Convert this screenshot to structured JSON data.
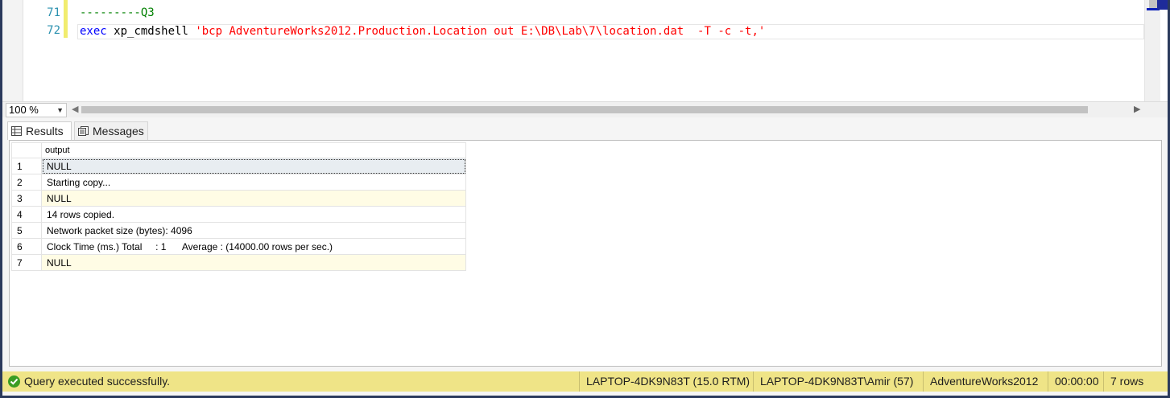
{
  "editor": {
    "lines": [
      {
        "number": "71",
        "text": "---------Q3"
      },
      {
        "number": "72",
        "keyword": "exec",
        "proc": "xp_cmdshell",
        "string": "'bcp AdventureWorks2012.Production.Location out E:\\DB\\Lab\\7\\location.dat  -T -c -t,'"
      }
    ]
  },
  "zoom": {
    "value": "100 %"
  },
  "tabs": {
    "results": "Results",
    "messages": "Messages"
  },
  "grid": {
    "column": "output",
    "rows": [
      {
        "n": "1",
        "v": "NULL"
      },
      {
        "n": "2",
        "v": "Starting copy..."
      },
      {
        "n": "3",
        "v": "NULL"
      },
      {
        "n": "4",
        "v": "14 rows copied."
      },
      {
        "n": "5",
        "v": "Network packet size (bytes): 4096"
      },
      {
        "n": "6",
        "v": "Clock Time (ms.) Total     : 1      Average : (14000.00 rows per sec.)"
      },
      {
        "n": "7",
        "v": "NULL"
      }
    ]
  },
  "status": {
    "message": "Query executed successfully.",
    "server": "LAPTOP-4DK9N83T (15.0 RTM)",
    "user": "LAPTOP-4DK9N83T\\Amir (57)",
    "database": "AdventureWorks2012",
    "elapsed": "00:00:00",
    "rows": "7 rows"
  },
  "colors": {
    "status_bar": "#efe487",
    "keyword": "#0000ff",
    "string": "#ff0000",
    "comment": "#008000",
    "line_number": "#2b91af"
  }
}
